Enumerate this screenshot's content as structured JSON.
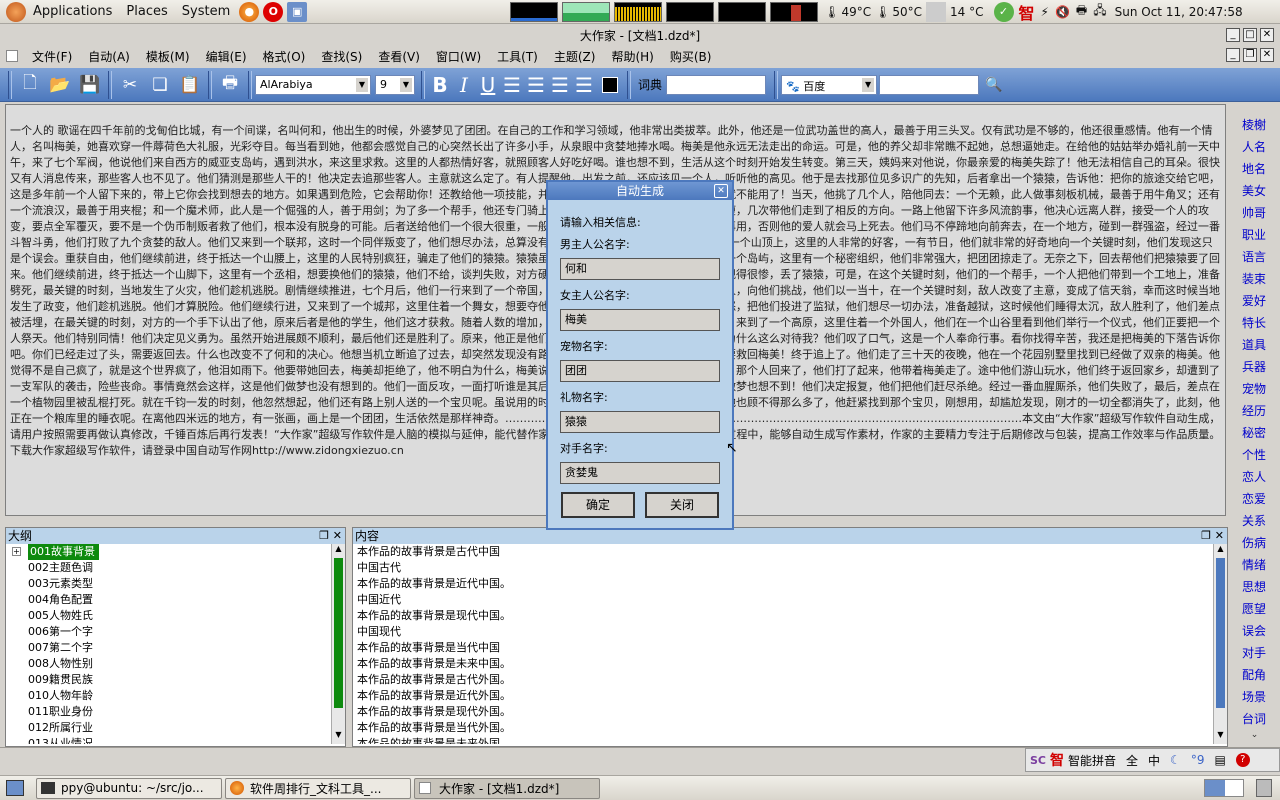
{
  "top_panel": {
    "menus": [
      "Applications",
      "Places",
      "System"
    ],
    "cpu_temp": "49°C",
    "gpu_temp": "50°C",
    "weather_temp": "14 °C",
    "ime_icon": "智",
    "clock": "Sun Oct 11, 20:47:58"
  },
  "window": {
    "title": "大作家 - [文档1.dzd*]"
  },
  "menubar": {
    "items": [
      "文件(F)",
      "自动(A)",
      "模板(M)",
      "编辑(E)",
      "格式(O)",
      "查找(S)",
      "查看(V)",
      "窗口(W)",
      "工具(T)",
      "主题(Z)",
      "帮助(H)",
      "购买(B)"
    ]
  },
  "toolbar": {
    "font_name": "AlArabiya",
    "font_size": "9",
    "dict_label": "词典",
    "dict_value": "",
    "search_engine": "百度",
    "search_value": ""
  },
  "editor": {
    "text": "一个人的 歌谣在四千年前的戈甸伯比城，有一个间谍，名叫何和，他出生的时候，外婆梦见了团团。在自己的工作和学习领域，他非常出类拔萃。此外，他还是一位武功盖世的高人，最善于用三头叉。仅有武功是不够的，他还很重感情。他有一个情人，名叫梅美，她喜欢穿一件蓐荷色大礼服，光彩夺目。每当看到她，他都会感觉自己的心突然长出了许多小手，从泉眼中贪婪地捧水喝。梅美是他永远无法走出的命运。可是，他的养父却非常瞧不起她，总想逼她走。在给他的姑姑举办婚礼前一天中午，来了七个军阀，他说他们来自西方的威亚支岛屿，遇到洪水，来这里求救。这里的人都热情好客，就照顾客人好吃好喝。谁也想不到，生活从这个时刻开始发生转变。第三天，姨妈来对他说，你最亲爱的梅美失踪了！他无法相信自己的耳朵。很快又有人消息传来，那些客人也不见了。他们猜测是那些人干的！他决定去追那些客人。主意就这么定了。有人提醒他，出发之前，还应该见一个人，听听他的高见。他于是去找那位见多识广的先知，后者拿出一个猿猿，告诉他：把你的旅途交给它吧，这是多年前一个人留下来的，带上它你会找到想去的地方。如果遇到危险，它会帮助你！还教给他一项技能，并告诉他，这个技能只能用一次，以后就不能用了！当天，他挑了几个人，陪他同去：一个无赖，此人做事刻板机械，最善于用牛角叉；还有一个流浪汉，最善于用夹棍；和一个魔术师，此人是一个倔强的人，善于用剑；为了多一个帮手，他还专门骑上团团，这是他最心爱的宠物，它特别瘦，几次带他们走到了相反的方向。一路上他留下许多风流韵事，他决心远离人群，接受一个人的攻变，要点全军覆灭，要不是一个伪币制贩者救了他们，根本没有脱身的可能。后者送给他们一个很大很重，一般人拿不动的剪刀，喔咐他们关键时刻再用，否则他的爱人就会马上死去。他们马不停蹄地向前奔去，在一个地方，碰到一群强盗，经过一番斗智斗勇，他们打败了九个贪婪的敌人。他们又来到一个联邦，这时一个同伴叛变了，他们想尽办法，总算没有失去他/它。他们继续前进，终于抵达一个山顶上，这里的人非常的好客，一有节日，他们就非常的好奇地向一个关键时刻，他们发现这只是个误会。重获自由，他们继续前进，终于抵达一个山腰上，这里的人民特别疯狂，骗走了他们的猿猿。猿猿虽丢，他们还要继续赶路，终于来到了一个岛屿，这里有一个秘密组织，他们非常强大，把团团掠走了。无奈之下，回去帮他们把猿猿要了回来。他们继续前进，终于抵达一个山脚下，这里有一个丞相，想要换他们的猿猿，他们不给，谈判失败，对方硬抢，双方打了起来，他们不敌，他们舰得很惨，丢了猿猿，可是，在这个关键时刻，他们的一个帮手，一个人把他们带到一个工地上，准备劈死，最关键的时刻，当地发生了火灾，他们趁机逃脱。剧情继续推进，七个月后，他们一行来到了一个帝国，这里有一个歌手，是他同伴以前的仇人，向他们挑战，他们以一当十，在一个关键时刻，敌人改变了主意，变成了信天翁，幸而这时候当地发生了政变，他们趁机逃脱。他们才算脱险。他们继续行进，又来到了一个城邦，这里住着一个舞女，想要夺他们的猿猿，遭到反击，这些人恼羞成怒，把他们投进了监狱，他们想尽一切办法，准备越狱，这时候他们睡得太沉，敌人胜利了，他们差点被活埋，在最关键的时刻，对方的一个手下认出了他，原来后者是他的学生，他们这才获救。随着人数的增加，他们的队伍不断扩大。他们马不停蹄，来到了一个高原，这里住着一个外国人，他们在一个山谷里看到他们举行一个仪式，他们正要把一个人祭天。他们特别同情！他们决定见义勇为。虽然开始进展颇不顺利，最后他们还是胜利了。原来，他正是他们要找的客人！他说，我好好对你，你为什么这么对待我？他们叹了口气，这是一个人奉命行事。看你找得辛苦，我还是把梅美的下落告诉你吧。你们已经走过了头，需要返回去。什么也改变不了何和的决心。他想当机立断追了过去，却突然发现没有路费，只好卖掉同伴，无论如何，他都要救回梅美！终于追上了。他们走了三十天的夜晚，他在一个花园别墅里找到已经做了双亲的梅美。他觉得不是自己疯了，就是这个世界疯了，他泪如雨下。他要带她回去，梅美却拒绝了，他不明白为什么，梅美说，我已经习惯了这里的生活，这时候，那个人回来了，他们打了起来，他带着梅美走了。途中他们游山玩水，他们终于返回家乡，却遭到了一支军队的袭击，险些丧命。事情竟然会这样，这是他们做梦也没有想到的。他们一面反攻，一面打听谁是其后主谋。原来是他们的一个邻居，他们做梦也想不到！他们决定报复，他们把他们赶尽杀绝。经过一番血腥厮杀，他们失败了，最后，差点在一个植物园里被乱棍打死。就在千钧一发的时刻，他忽然想起，他们还有路上别人送的一个宝贝呢。虽说用的时候会有危险，然而，在这生死关头，他也顾不得那么多了，他赶紧找到那个宝贝，刚想用，却尴尬发现，刚才的一切全都消失了，此刻，他正在一个粮库里的睡衣呢。在离他四米远的地方，有一张画，画上是一个团团，生活依然是那样神奇。……………………………………………………………………………………………………………………………本文由“大作家”超级写作软件自动生成，请用户按照需要再做认真修改，千锤百炼后再行发表！“大作家”超级写作软件是人脑的模拟与延伸，能代替作家进行大量重复、繁琐的工作，在写作过程中，能够自动生成写作素材，作家的主要精力专注于后期修改与包装，提高工作效率与作品质量。下载大作家超级写作软件，请登录中国自动写作网http://www.zidongxiezuo.cn"
  },
  "sidebar": {
    "items": [
      "棱榭",
      "人名",
      "地名",
      "美女",
      "帅哥",
      "职业",
      "语言",
      "装束",
      "爱好",
      "特长",
      "道具",
      "兵器",
      "宠物",
      "经历",
      "秘密",
      "个性",
      "恋人",
      "恋爱",
      "关系",
      "伤病",
      "情绪",
      "思想",
      "愿望",
      "误会",
      "对手",
      "配角",
      "场景",
      "台词"
    ]
  },
  "dialog": {
    "title": "自动生成",
    "prompt": "请输入相关信息:",
    "male_label": "男主人公名字:",
    "male_value": "何和",
    "female_label": "女主人公名字:",
    "female_value": "梅美",
    "pet_label": "宠物名字:",
    "pet_value": "团团",
    "gift_label": "礼物名字:",
    "gift_value": "猿猿",
    "rival_label": "对手名字:",
    "rival_value": "贪婪鬼",
    "ok_label": "确定",
    "close_label": "关闭"
  },
  "outline": {
    "title": "大纲",
    "items": [
      "001故事背景",
      "002主题色调",
      "003元素类型",
      "004角色配置",
      "005人物姓氏",
      "006第一个字",
      "007第二个字",
      "008人物性别",
      "009籍贯民族",
      "010人物年龄",
      "011职业身份",
      "012所属行业",
      "013从业情况"
    ]
  },
  "content": {
    "title": "内容",
    "lines": [
      "本作品的故事背景是古代中国",
      "中国古代",
      "本作品的故事背景是近代中国。",
      "中国近代",
      "本作品的故事背景是现代中国。",
      "中国现代",
      "本作品的故事背景是当代中国",
      "本作品的故事背景是未来中国。",
      "本作品的故事背景是古代外国。",
      "本作品的故事背景是近代外国。",
      "本作品的故事背景是现代外国。",
      "本作品的故事背景是当代外国。",
      "本作品的故事背景是未来外国。"
    ]
  },
  "ime_bar": {
    "logo": "智",
    "name": "智能拼音",
    "width_mode": "全",
    "lang_mode": "中"
  },
  "taskbar": {
    "tasks": [
      "ppy@ubuntu: ~/src/jo...",
      "软件周排行_文科工具_...",
      "大作家 - [文档1.dzd*]"
    ]
  }
}
